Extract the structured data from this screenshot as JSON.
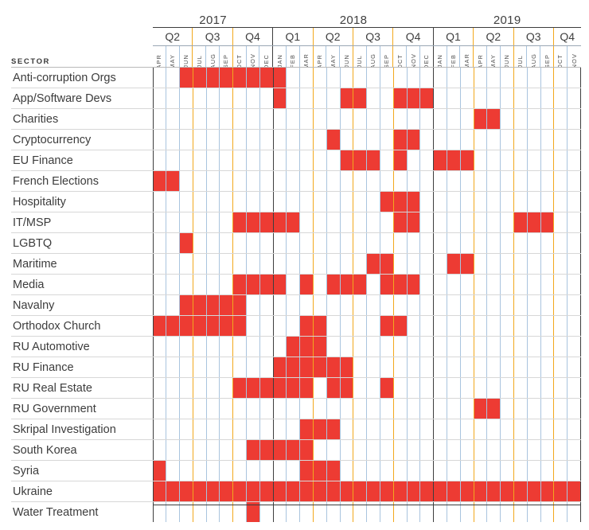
{
  "header": {
    "sector_label": "SECTOR"
  },
  "colors": {
    "active_cell": "#ED3B33",
    "quarter_line": "#F2A81D",
    "month_line": "#A9C4DE",
    "year_line": "#3D3D3D"
  },
  "chart_data": {
    "type": "heatmap",
    "title": "",
    "xlabel": "",
    "ylabel": "SECTOR",
    "legend": [],
    "grid": true,
    "years": [
      {
        "label": "2017",
        "months": 9
      },
      {
        "label": "2018",
        "months": 12
      },
      {
        "label": "2019",
        "months": 11
      }
    ],
    "quarters": [
      {
        "label": "Q2",
        "year": "2017",
        "months": 3
      },
      {
        "label": "Q3",
        "year": "2017",
        "months": 3
      },
      {
        "label": "Q4",
        "year": "2017",
        "months": 3
      },
      {
        "label": "Q1",
        "year": "2018",
        "months": 3
      },
      {
        "label": "Q2",
        "year": "2018",
        "months": 3
      },
      {
        "label": "Q3",
        "year": "2018",
        "months": 3
      },
      {
        "label": "Q4",
        "year": "2018",
        "months": 3
      },
      {
        "label": "Q1",
        "year": "2019",
        "months": 3
      },
      {
        "label": "Q2",
        "year": "2019",
        "months": 3
      },
      {
        "label": "Q3",
        "year": "2019",
        "months": 3
      },
      {
        "label": "Q4",
        "year": "2019",
        "months": 2
      }
    ],
    "x": [
      "APR",
      "MAY",
      "JUN",
      "JUL",
      "AUG",
      "SEP",
      "OCT",
      "NOV",
      "DEC",
      "JAN",
      "FEB",
      "MAR",
      "APR",
      "MAY",
      "JUN",
      "JUL",
      "AUG",
      "SEP",
      "OCT",
      "NOV",
      "DEC",
      "JAN",
      "FEB",
      "MAR",
      "APR",
      "MAY",
      "JUN",
      "JUL",
      "AUG",
      "SEP",
      "OCT",
      "NOV"
    ],
    "x_full": [
      "APR 2017",
      "MAY 2017",
      "JUN 2017",
      "JUL 2017",
      "AUG 2017",
      "SEP 2017",
      "OCT 2017",
      "NOV 2017",
      "DEC 2017",
      "JAN 2018",
      "FEB 2018",
      "MAR 2018",
      "APR 2018",
      "MAY 2018",
      "JUN 2018",
      "JUL 2018",
      "AUG 2018",
      "SEP 2018",
      "OCT 2018",
      "NOV 2018",
      "DEC 2018",
      "JAN 2019",
      "FEB 2019",
      "MAR 2019",
      "APR 2019",
      "MAY 2019",
      "JUN 2019",
      "JUL 2019",
      "AUG 2019",
      "SEP 2019",
      "OCT 2019",
      "NOV 2019"
    ],
    "categories": [
      "Anti-corruption Orgs",
      "App/Software Devs",
      "Charities",
      "Cryptocurrency",
      "EU Finance",
      "French Elections",
      "Hospitality",
      "IT/MSP",
      "LGBTQ",
      "Maritime",
      "Media",
      "Navalny",
      "Orthodox Church",
      "RU Automotive",
      "RU Finance",
      "RU Real Estate",
      "RU Government",
      "Skripal Investigation",
      "South Korea",
      "Syria",
      "Ukraine",
      "Water Treatment"
    ],
    "values": [
      [
        0,
        0,
        1,
        1,
        1,
        1,
        1,
        1,
        1,
        1,
        0,
        0,
        0,
        0,
        0,
        0,
        0,
        0,
        0,
        0,
        0,
        0,
        0,
        0,
        0,
        0,
        0,
        0,
        0,
        0,
        0,
        0
      ],
      [
        0,
        0,
        0,
        0,
        0,
        0,
        0,
        0,
        0,
        1,
        0,
        0,
        0,
        0,
        1,
        1,
        0,
        0,
        1,
        1,
        1,
        0,
        0,
        0,
        0,
        0,
        0,
        0,
        0,
        0,
        0,
        0
      ],
      [
        0,
        0,
        0,
        0,
        0,
        0,
        0,
        0,
        0,
        0,
        0,
        0,
        0,
        0,
        0,
        0,
        0,
        0,
        0,
        0,
        0,
        0,
        0,
        0,
        1,
        1,
        0,
        0,
        0,
        0,
        0,
        0
      ],
      [
        0,
        0,
        0,
        0,
        0,
        0,
        0,
        0,
        0,
        0,
        0,
        0,
        0,
        1,
        0,
        0,
        0,
        0,
        1,
        1,
        0,
        0,
        0,
        0,
        0,
        0,
        0,
        0,
        0,
        0,
        0,
        0
      ],
      [
        0,
        0,
        0,
        0,
        0,
        0,
        0,
        0,
        0,
        0,
        0,
        0,
        0,
        0,
        1,
        1,
        1,
        0,
        1,
        0,
        0,
        1,
        1,
        1,
        0,
        0,
        0,
        0,
        0,
        0,
        0,
        0
      ],
      [
        1,
        1,
        0,
        0,
        0,
        0,
        0,
        0,
        0,
        0,
        0,
        0,
        0,
        0,
        0,
        0,
        0,
        0,
        0,
        0,
        0,
        0,
        0,
        0,
        0,
        0,
        0,
        0,
        0,
        0,
        0,
        0
      ],
      [
        0,
        0,
        0,
        0,
        0,
        0,
        0,
        0,
        0,
        0,
        0,
        0,
        0,
        0,
        0,
        0,
        0,
        1,
        1,
        1,
        0,
        0,
        0,
        0,
        0,
        0,
        0,
        0,
        0,
        0,
        0,
        0
      ],
      [
        0,
        0,
        0,
        0,
        0,
        0,
        1,
        1,
        1,
        1,
        1,
        0,
        0,
        0,
        0,
        0,
        0,
        0,
        1,
        1,
        0,
        0,
        0,
        0,
        0,
        0,
        0,
        1,
        1,
        1,
        0,
        0
      ],
      [
        0,
        0,
        1,
        0,
        0,
        0,
        0,
        0,
        0,
        0,
        0,
        0,
        0,
        0,
        0,
        0,
        0,
        0,
        0,
        0,
        0,
        0,
        0,
        0,
        0,
        0,
        0,
        0,
        0,
        0,
        0,
        0
      ],
      [
        0,
        0,
        0,
        0,
        0,
        0,
        0,
        0,
        0,
        0,
        0,
        0,
        0,
        0,
        0,
        0,
        1,
        1,
        0,
        0,
        0,
        0,
        1,
        1,
        0,
        0,
        0,
        0,
        0,
        0,
        0,
        0
      ],
      [
        0,
        0,
        0,
        0,
        0,
        0,
        1,
        1,
        1,
        1,
        0,
        1,
        0,
        1,
        1,
        1,
        0,
        1,
        1,
        1,
        0,
        0,
        0,
        0,
        0,
        0,
        0,
        0,
        0,
        0,
        0,
        0
      ],
      [
        0,
        0,
        1,
        1,
        1,
        1,
        1,
        0,
        0,
        0,
        0,
        0,
        0,
        0,
        0,
        0,
        0,
        0,
        0,
        0,
        0,
        0,
        0,
        0,
        0,
        0,
        0,
        0,
        0,
        0,
        0,
        0
      ],
      [
        1,
        1,
        1,
        1,
        1,
        1,
        1,
        0,
        0,
        0,
        0,
        1,
        1,
        0,
        0,
        0,
        0,
        1,
        1,
        0,
        0,
        0,
        0,
        0,
        0,
        0,
        0,
        0,
        0,
        0,
        0,
        0
      ],
      [
        0,
        0,
        0,
        0,
        0,
        0,
        0,
        0,
        0,
        0,
        1,
        1,
        1,
        0,
        0,
        0,
        0,
        0,
        0,
        0,
        0,
        0,
        0,
        0,
        0,
        0,
        0,
        0,
        0,
        0,
        0,
        0
      ],
      [
        0,
        0,
        0,
        0,
        0,
        0,
        0,
        0,
        0,
        1,
        1,
        1,
        1,
        1,
        1,
        0,
        0,
        0,
        0,
        0,
        0,
        0,
        0,
        0,
        0,
        0,
        0,
        0,
        0,
        0,
        0,
        0
      ],
      [
        0,
        0,
        0,
        0,
        0,
        0,
        1,
        1,
        1,
        1,
        1,
        1,
        0,
        1,
        1,
        0,
        0,
        1,
        0,
        0,
        0,
        0,
        0,
        0,
        0,
        0,
        0,
        0,
        0,
        0,
        0,
        0
      ],
      [
        0,
        0,
        0,
        0,
        0,
        0,
        0,
        0,
        0,
        0,
        0,
        0,
        0,
        0,
        0,
        0,
        0,
        0,
        0,
        0,
        0,
        0,
        0,
        0,
        1,
        1,
        0,
        0,
        0,
        0,
        0,
        0
      ],
      [
        0,
        0,
        0,
        0,
        0,
        0,
        0,
        0,
        0,
        0,
        0,
        1,
        1,
        1,
        0,
        0,
        0,
        0,
        0,
        0,
        0,
        0,
        0,
        0,
        0,
        0,
        0,
        0,
        0,
        0,
        0,
        0
      ],
      [
        0,
        0,
        0,
        0,
        0,
        0,
        0,
        1,
        1,
        1,
        1,
        1,
        0,
        0,
        0,
        0,
        0,
        0,
        0,
        0,
        0,
        0,
        0,
        0,
        0,
        0,
        0,
        0,
        0,
        0,
        0,
        0
      ],
      [
        1,
        0,
        0,
        0,
        0,
        0,
        0,
        0,
        0,
        0,
        0,
        1,
        1,
        1,
        0,
        0,
        0,
        0,
        0,
        0,
        0,
        0,
        0,
        0,
        0,
        0,
        0,
        0,
        0,
        0,
        0,
        0
      ],
      [
        1,
        1,
        1,
        1,
        1,
        1,
        1,
        1,
        1,
        1,
        1,
        1,
        1,
        1,
        1,
        1,
        1,
        1,
        1,
        1,
        1,
        1,
        1,
        1,
        1,
        1,
        1,
        1,
        1,
        1,
        1,
        1
      ],
      [
        0,
        0,
        0,
        0,
        0,
        0,
        0,
        1,
        0,
        0,
        0,
        0,
        0,
        0,
        0,
        0,
        0,
        0,
        0,
        0,
        0,
        0,
        0,
        0,
        0,
        0,
        0,
        0,
        0,
        0,
        0,
        0
      ]
    ]
  }
}
